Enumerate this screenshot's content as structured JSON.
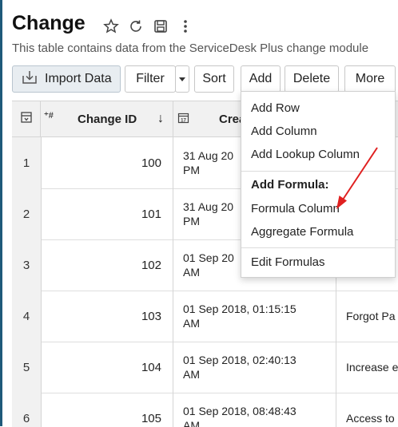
{
  "page": {
    "title": "Change",
    "subtitle": "This table contains data from the ServiceDesk Plus change module"
  },
  "title_icons": [
    "star-icon",
    "refresh-icon",
    "save-icon",
    "more-vertical-icon"
  ],
  "toolbar": {
    "import_label": "Import Data",
    "filter_label": "Filter",
    "sort_label": "Sort",
    "add_label": "Add",
    "delete_label": "Delete",
    "more_label": "More"
  },
  "table": {
    "columns": {
      "change_id": "Change ID",
      "created": "Crea"
    },
    "rows": [
      {
        "num": "1",
        "id": "100",
        "date_1": "31 Aug 20",
        "date_2": "PM",
        "title": ""
      },
      {
        "num": "2",
        "id": "101",
        "date_1": "31 Aug 20",
        "date_2": "PM",
        "title": ""
      },
      {
        "num": "3",
        "id": "102",
        "date_1": "01 Sep 20",
        "date_2": "AM",
        "title": ""
      },
      {
        "num": "4",
        "id": "103",
        "date_1": "01 Sep 2018, 01:15:15",
        "date_2": "AM",
        "title": "Forgot Pa"
      },
      {
        "num": "5",
        "id": "104",
        "date_1": "01 Sep 2018, 02:40:13",
        "date_2": "AM",
        "title": "Increase e"
      },
      {
        "num": "6",
        "id": "105",
        "date_1": "01 Sep 2018, 08:48:43",
        "date_2": "AM",
        "title": "Access to"
      }
    ]
  },
  "add_menu": {
    "add_row": "Add Row",
    "add_column": "Add Column",
    "add_lookup_column": "Add Lookup Column",
    "formula_heading": "Add Formula:",
    "formula_column": "Formula Column",
    "aggregate_formula": "Aggregate Formula",
    "edit_formulas": "Edit Formulas"
  },
  "colors": {
    "annotation_arrow": "#e02020",
    "accent": "#1f5a7a"
  }
}
